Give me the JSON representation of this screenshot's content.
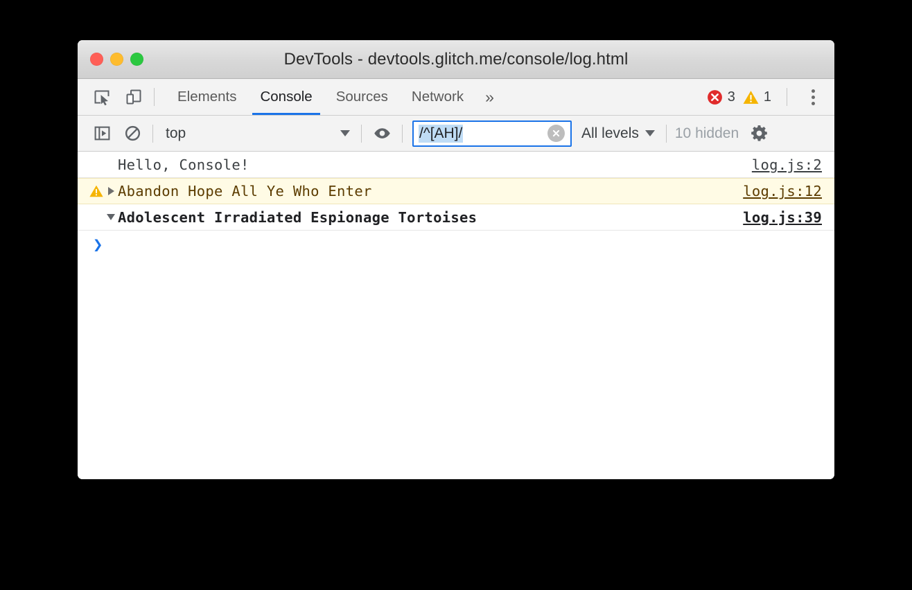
{
  "window": {
    "title": "DevTools - devtools.glitch.me/console/log.html",
    "traffic_lights": [
      "close",
      "minimize",
      "zoom"
    ]
  },
  "tabbar": {
    "inspect_icon": "inspect-element-icon",
    "device_icon": "device-toolbar-icon",
    "tabs": [
      {
        "label": "Elements",
        "active": false
      },
      {
        "label": "Console",
        "active": true
      },
      {
        "label": "Sources",
        "active": false
      },
      {
        "label": "Network",
        "active": false
      }
    ],
    "more_tabs_label": "»",
    "error_count": "3",
    "warning_count": "1",
    "menu_icon": "kebab-menu-icon"
  },
  "console_toolbar": {
    "sidebar_toggle_icon": "console-sidebar-toggle-icon",
    "clear_icon": "clear-console-icon",
    "context": "top",
    "eye_icon": "live-expression-eye-icon",
    "filter": {
      "value": "/^[AH]/",
      "placeholder": "Filter",
      "selected": true,
      "clear_icon": "clear-filter-icon"
    },
    "levels_label": "All levels",
    "hidden_label": "10 hidden",
    "settings_icon": "settings-gear-icon"
  },
  "messages": [
    {
      "level": "log",
      "icon": null,
      "arrow": null,
      "text": "Hello, Console!",
      "source": "log.js:2"
    },
    {
      "level": "warning",
      "icon": "warning-triangle-icon",
      "arrow": "collapsed",
      "text": "Abandon Hope All Ye Who Enter",
      "source": "log.js:12"
    },
    {
      "level": "bold",
      "icon": null,
      "arrow": "expanded",
      "text": "Adolescent Irradiated Espionage Tortoises",
      "source": "log.js:39"
    }
  ],
  "prompt": {
    "chevron": "❯",
    "value": ""
  },
  "colors": {
    "accent": "#1a73e8",
    "error": "#e02b2b",
    "warning": "#f5b400",
    "warning_row_bg": "#fffbe5",
    "warning_text": "#5c3c00",
    "selection": "#bfdcf5"
  }
}
